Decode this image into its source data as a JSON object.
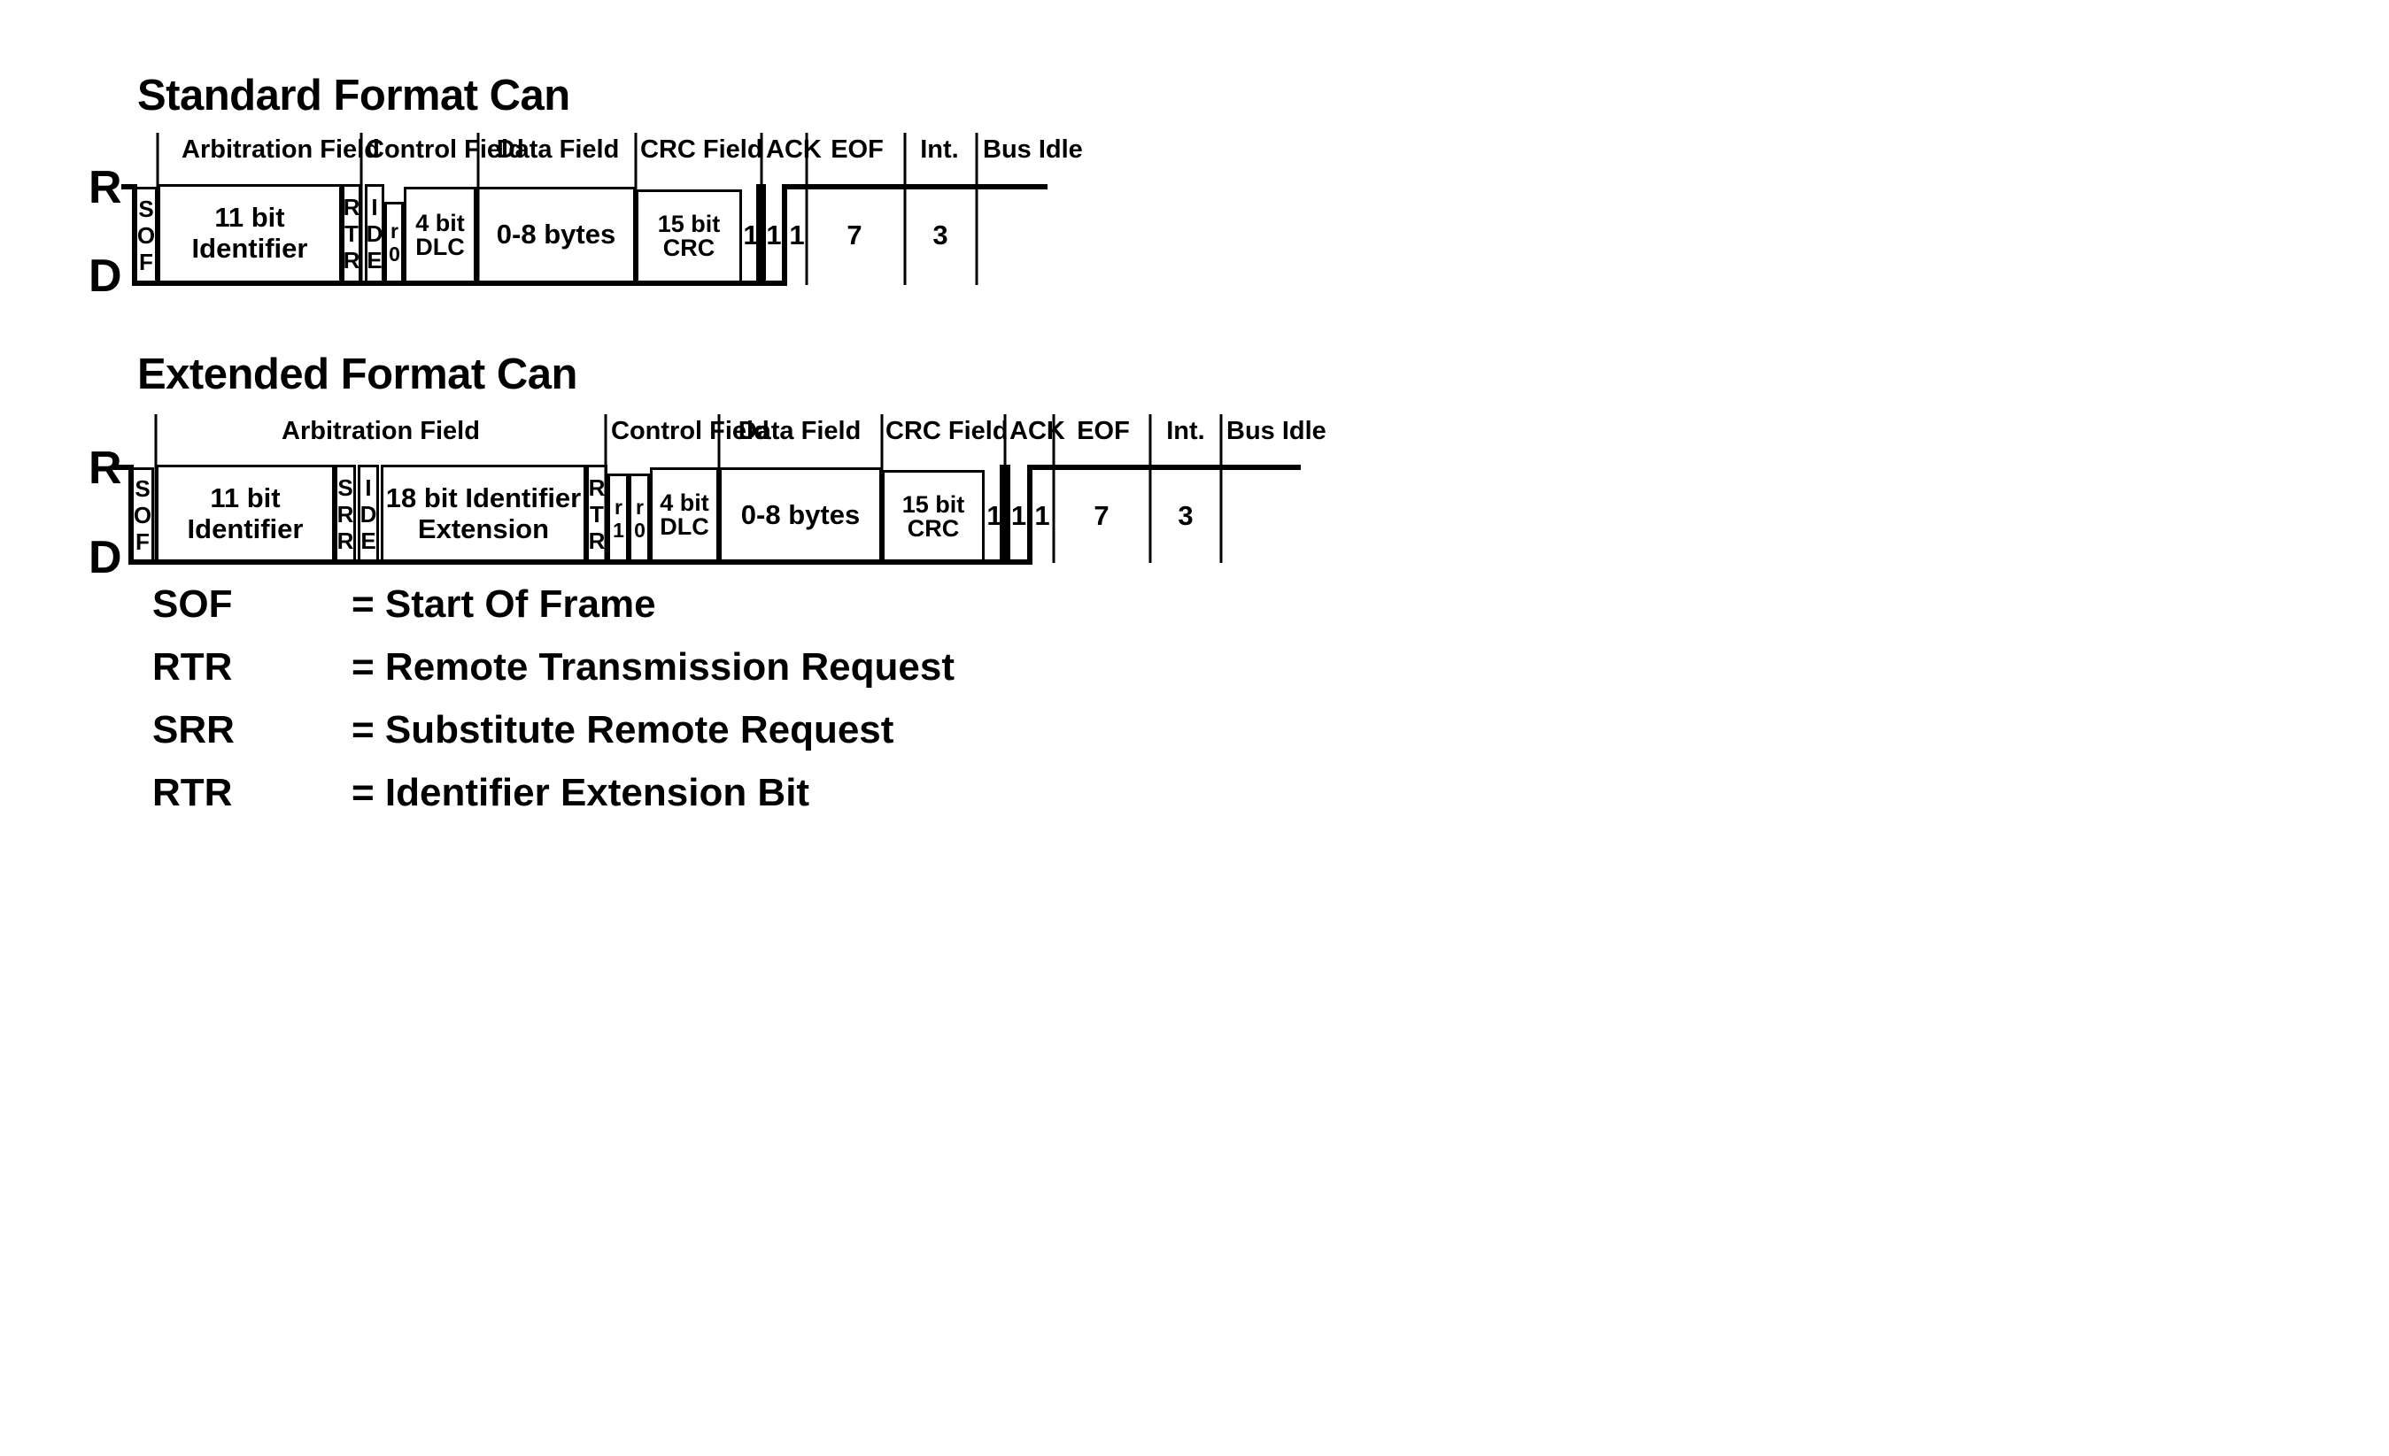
{
  "document": {
    "kind": "CAN bus frame format timing diagram"
  },
  "standard": {
    "title": "Standard Format Can",
    "rail_top_label": "R",
    "rail_bottom_label": "D",
    "group_labels": [
      "Arbitration Field",
      "Control Field",
      "Data Field",
      "CRC Field",
      "ACK",
      "EOF",
      "Int.",
      "Bus Idle"
    ],
    "fields": [
      "SOF",
      "11 bit Identifier",
      "RTR",
      "IDE",
      "r0",
      "4 bit\nDLC",
      "0-8 bytes",
      "15 bit\nCRC"
    ],
    "bit_counts": [
      "1",
      "1",
      "1",
      "7",
      "3"
    ]
  },
  "extended": {
    "title": "Extended Format Can",
    "rail_top_label": "R",
    "rail_bottom_label": "D",
    "group_labels": [
      "Arbitration Field",
      "Control Field",
      "Data Field",
      "CRC Field",
      "ACK",
      "EOF",
      "Int.",
      "Bus Idle"
    ],
    "fields": [
      "SOF",
      "11 bit Identifier",
      "SRR",
      "IDE",
      "18 bit Identifier\nExtension",
      "RTR",
      "r1",
      "r0",
      "4 bit\nDLC",
      "0-8 bytes",
      "15 bit\nCRC"
    ],
    "bit_counts": [
      "1",
      "1",
      "1",
      "7",
      "3"
    ]
  },
  "legend": {
    "rows": [
      {
        "abbr": "SOF",
        "def": "= Start Of Frame"
      },
      {
        "abbr": "RTR",
        "def": "= Remote Transmission Request"
      },
      {
        "abbr": "SRR",
        "def": "= Substitute Remote Request"
      },
      {
        "abbr": "RTR",
        "def": "= Identifier Extension Bit"
      }
    ]
  },
  "colors": {
    "ink": "#000000",
    "paper": "#ffffff"
  }
}
